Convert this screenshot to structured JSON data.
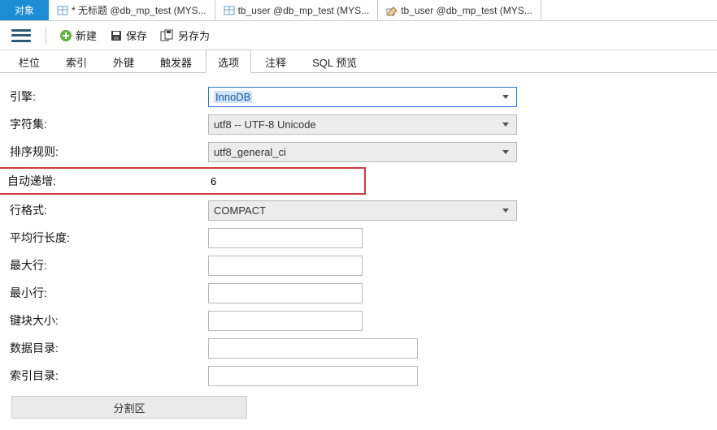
{
  "doc_tabs": {
    "t0": "对象",
    "t1": "* 无标题 @db_mp_test (MYS...",
    "t2": "tb_user @db_mp_test (MYS...",
    "t3": "tb_user @db_mp_test (MYS..."
  },
  "toolbar": {
    "new_label": "新建",
    "save_label": "保存",
    "saveas_label": "另存为"
  },
  "page_tabs": {
    "t0": "栏位",
    "t1": "索引",
    "t2": "外键",
    "t3": "触发器",
    "t4": "选项",
    "t5": "注释",
    "t6": "SQL 预览"
  },
  "labels": {
    "engine": "引擎:",
    "charset": "字符集:",
    "collation": "排序规则:",
    "auto_increment": "自动递增:",
    "row_format": "行格式:",
    "avg_row_len": "平均行长度:",
    "max_rows": "最大行:",
    "min_rows": "最小行:",
    "key_block": "键块大小:",
    "data_dir": "数据目录:",
    "index_dir": "索引目录:"
  },
  "values": {
    "engine": "InnoDB",
    "charset": "utf8 -- UTF-8 Unicode",
    "collation": "utf8_general_ci",
    "auto_increment": "6",
    "row_format": "COMPACT",
    "avg_row_len": "",
    "max_rows": "",
    "min_rows": "",
    "key_block": "",
    "data_dir": "",
    "index_dir": ""
  },
  "partition_label": "分割区"
}
